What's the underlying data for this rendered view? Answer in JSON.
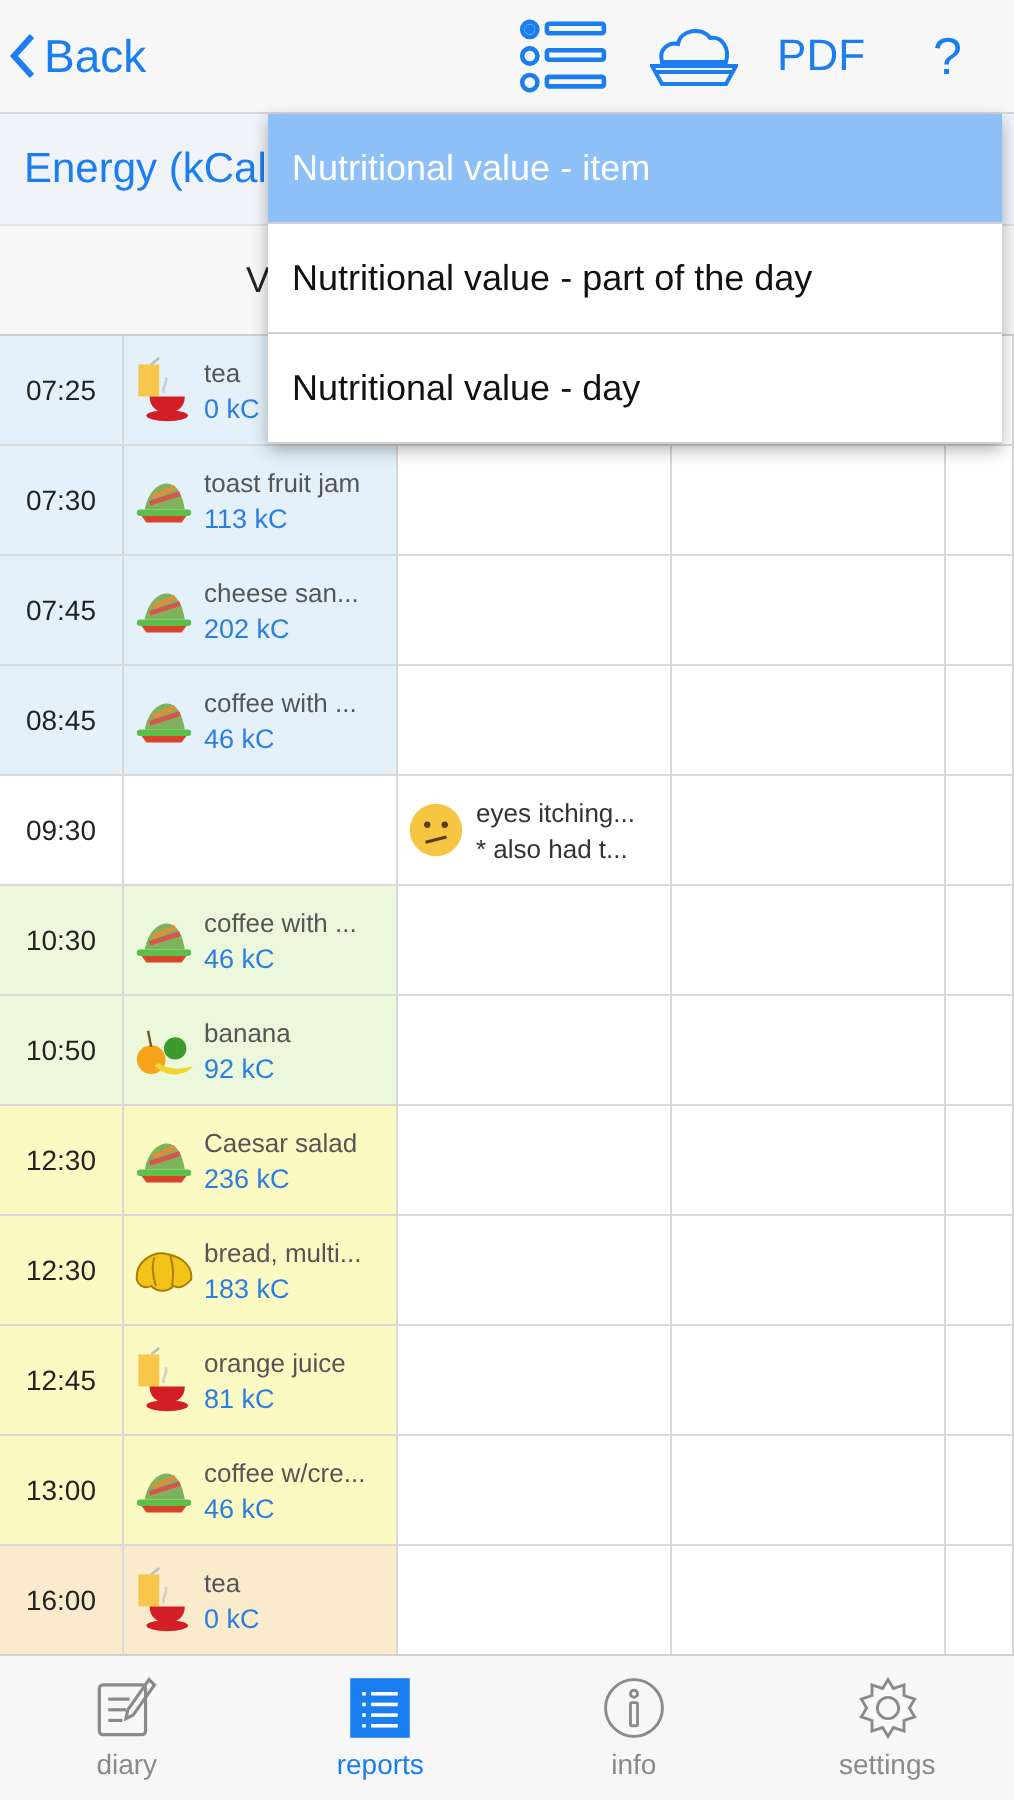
{
  "nav": {
    "back": "Back",
    "pdf": "PDF",
    "help": "?"
  },
  "header": {
    "title": "Energy (kCal",
    "column_header": "V"
  },
  "menu": [
    {
      "label": "Nutritional value - item",
      "selected": true
    },
    {
      "label": "Nutritional value - part of the day",
      "selected": false
    },
    {
      "label": "Nutritional value - day",
      "selected": false
    }
  ],
  "rows": [
    {
      "time": "07:25",
      "color": "#e4f1fb",
      "food": {
        "kind": "drink",
        "name": "tea",
        "energy": "0 kC"
      }
    },
    {
      "time": "07:30",
      "color": "#e4f1fb",
      "food": {
        "kind": "dish",
        "name": "toast fruit jam",
        "energy": "113 kC"
      }
    },
    {
      "time": "07:45",
      "color": "#e4f1fb",
      "food": {
        "kind": "dish",
        "name": "cheese san...",
        "energy": "202 kC"
      }
    },
    {
      "time": "08:45",
      "color": "#e4f1fb",
      "food": {
        "kind": "dish",
        "name": "coffee with ...",
        "energy": "46 kC"
      }
    },
    {
      "time": "09:30",
      "color": "#ffffff",
      "symptom": {
        "kind": "mood",
        "lines": [
          "eyes itching...",
          "* also had t..."
        ]
      }
    },
    {
      "time": "10:30",
      "color": "#ebf8dc",
      "food": {
        "kind": "dish",
        "name": "coffee with ...",
        "energy": "46 kC"
      }
    },
    {
      "time": "10:50",
      "color": "#ebf8dc",
      "food": {
        "kind": "fruit",
        "name": "banana",
        "energy": "92 kC"
      }
    },
    {
      "time": "12:30",
      "color": "#fbfac3",
      "food": {
        "kind": "dish",
        "name": "Caesar salad",
        "energy": "236 kC"
      }
    },
    {
      "time": "12:30",
      "color": "#fbfac3",
      "food": {
        "kind": "bread",
        "name": "bread, multi...",
        "energy": "183 kC"
      }
    },
    {
      "time": "12:45",
      "color": "#fbfac3",
      "food": {
        "kind": "drink",
        "name": "orange juice",
        "energy": "81 kC"
      }
    },
    {
      "time": "13:00",
      "color": "#fbfac3",
      "food": {
        "kind": "dish",
        "name": "coffee w/cre...",
        "energy": "46 kC"
      }
    },
    {
      "time": "16:00",
      "color": "#faebcc",
      "food": {
        "kind": "drink",
        "name": "tea",
        "energy": "0 kC"
      }
    }
  ],
  "tabs": [
    {
      "kind": "diary",
      "label": "diary",
      "selected": false
    },
    {
      "kind": "reports",
      "label": "reports",
      "selected": true
    },
    {
      "kind": "info",
      "label": "info",
      "selected": false
    },
    {
      "kind": "settings",
      "label": "settings",
      "selected": false
    }
  ]
}
